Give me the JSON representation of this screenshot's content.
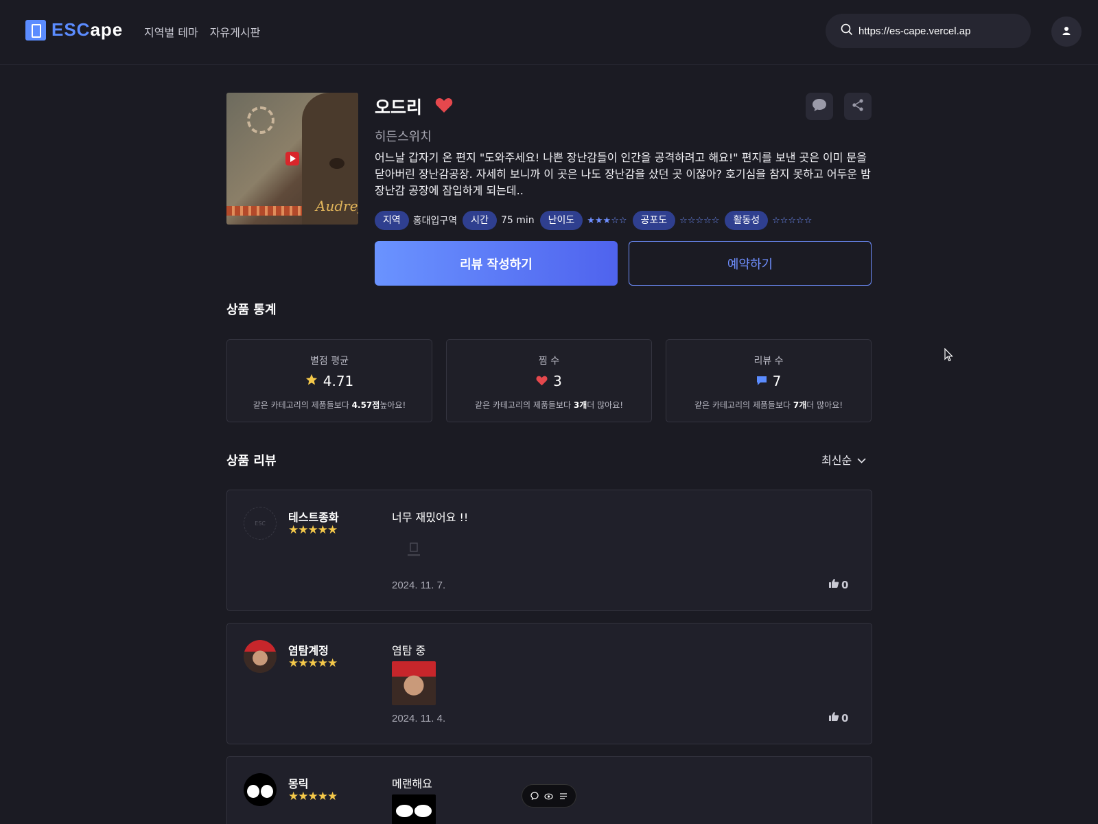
{
  "header": {
    "logo_text_a": "ESC",
    "logo_text_b": "ape",
    "nav": [
      "지역별 테마",
      "자유게시판"
    ],
    "search_value": "https://es-cape.vercel.ap"
  },
  "theme": {
    "poster_title": "Audrey",
    "title": "오드리",
    "company": "히든스위치",
    "description": "어느날 갑자기 온 편지 \"도와주세요! 나쁜 장난감들이 인간을 공격하려고 해요!\" 편지를 보낸 곳은 이미 문을 닫아버린 장난감공장. 자세히 보니까 이 곳은 나도 장난감을 샀던 곳 이잖아? 호기심을 참지 못하고 어두운 밤 장난감 공장에 잠입하게 되는데..",
    "tags": {
      "region_label": "지역",
      "region_value": "홍대입구역",
      "time_label": "시간",
      "time_value": "75 min",
      "difficulty_label": "난이도",
      "difficulty_stars": "★★★☆☆",
      "difficulty": 3,
      "fear_label": "공포도",
      "fear_stars": "☆☆☆☆☆",
      "fear": 0,
      "activity_label": "활동성",
      "activity_stars": "☆☆☆☆☆",
      "activity": 0
    },
    "review_button": "리뷰 작성하기",
    "book_button": "예약하기"
  },
  "stats": {
    "title": "상품 통계",
    "rating": {
      "label": "별점 평균",
      "value": "4.71",
      "note_pre": "같은 카테고리의 제품들보다 ",
      "note_bold": "4.57점",
      "note_post": "높아요!"
    },
    "likes": {
      "label": "찜 수",
      "value": "3",
      "note_pre": "같은 카테고리의 제품들보다 ",
      "note_bold": "3개",
      "note_post": "더 많아요!"
    },
    "reviews": {
      "label": "리뷰 수",
      "value": "7",
      "note_pre": "같은 카테고리의 제품들보다 ",
      "note_bold": "7개",
      "note_post": "더 많아요!"
    }
  },
  "reviews_section": {
    "title": "상품 리뷰",
    "sort_label": "최신순",
    "items": [
      {
        "name": "테스트종화",
        "stars": "★★★★★",
        "rating": 5,
        "text": "너무 재밌어요 !!",
        "date": "2024. 11. 7.",
        "likes": "0"
      },
      {
        "name": "염탐계정",
        "stars": "★★★★★",
        "rating": 5,
        "text": "염탐 중",
        "date": "2024. 11. 4.",
        "likes": "0"
      },
      {
        "name": "몽릭",
        "stars": "★★★★★",
        "rating": 5,
        "text": "메랜해요"
      }
    ]
  },
  "colors": {
    "background": "#1b1b23",
    "accent": "#5b8cff",
    "tag_bg": "#2f3f8f",
    "star_yellow": "#f4c84a",
    "heart_red": "#e5484d"
  }
}
